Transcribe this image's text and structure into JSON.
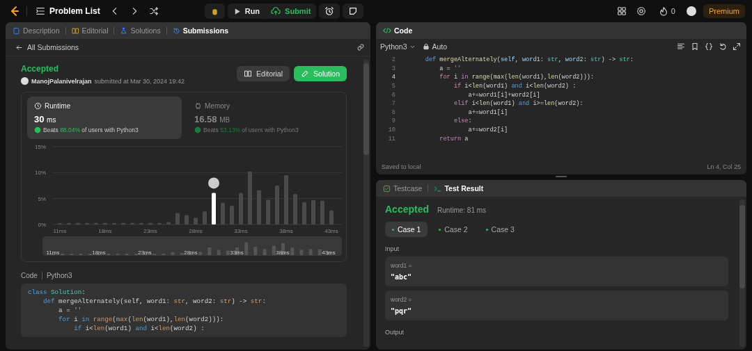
{
  "top_bar": {
    "title": "Problem List",
    "run_label": "Run",
    "submit_label": "Submit",
    "streak": "0",
    "premium": "Premium"
  },
  "left_panel": {
    "tabs": [
      {
        "label": "Description",
        "kind": "description",
        "selected": false
      },
      {
        "label": "Editorial",
        "kind": "editorial",
        "selected": false
      },
      {
        "label": "Solutions",
        "kind": "solutions",
        "selected": false
      },
      {
        "label": "Submissions",
        "kind": "submissions",
        "selected": true
      }
    ],
    "back_label": "All Submissions",
    "submission": {
      "status": "Accepted",
      "user": "ManojPalanivelrajan",
      "submitted_text": "submitted at Mar 30, 2024 19:42",
      "editorial_button": "Editorial",
      "solution_button": "Solution"
    },
    "metrics": [
      {
        "kind": "runtime",
        "label": "Runtime",
        "value": "30",
        "unit": "ms",
        "beats_label": "Beats",
        "beats_value": "88.04%",
        "beats_rest": "of users with Python3",
        "selected": true
      },
      {
        "kind": "memory",
        "label": "Memory",
        "value": "16.58",
        "unit": "MB",
        "beats_label": "Beats",
        "beats_value": "53.13%",
        "beats_rest": "of users with Python3",
        "selected": false
      }
    ],
    "chart_data": {
      "type": "bar",
      "categories": [
        "11ms",
        null,
        null,
        null,
        null,
        "18ms",
        null,
        null,
        null,
        null,
        "23ms",
        null,
        null,
        null,
        null,
        "28ms",
        null,
        null,
        null,
        null,
        "33ms",
        null,
        null,
        null,
        null,
        "38ms",
        null,
        null,
        null,
        null,
        "43ms"
      ],
      "series": [
        {
          "color": "#4a4a4a",
          "values": [
            0.2,
            0.3,
            0.3,
            0.3,
            0.3,
            0.3,
            0.3,
            0.3,
            0.3,
            0.3,
            0.3,
            0.3,
            0.5,
            2.2,
            1.8,
            1.3,
            2.5,
            null,
            4.2,
            3.6,
            6.1,
            10.2,
            6.6,
            4.8,
            7.5,
            9.5,
            5.9,
            4.3,
            4.7,
            4.6,
            2.7
          ]
        },
        {
          "color": "#ffffff",
          "values": [
            null,
            null,
            null,
            null,
            null,
            null,
            null,
            null,
            null,
            null,
            null,
            null,
            null,
            null,
            null,
            null,
            null,
            6.1,
            null,
            null,
            null,
            null,
            null,
            null,
            null,
            null,
            null,
            null,
            null,
            null,
            null
          ]
        }
      ],
      "ylim": [
        0,
        15
      ],
      "yticks": [
        {
          "value": 0,
          "label": "0%"
        },
        {
          "value": 5,
          "label": "5%"
        },
        {
          "value": 10,
          "label": "10%"
        },
        {
          "value": 15,
          "label": "15%"
        }
      ]
    },
    "navigator_labels": [
      "11ms",
      "18ms",
      "23ms",
      "28ms",
      "33ms",
      "38ms",
      "43ms"
    ],
    "code_header": {
      "label": "Code",
      "language": "Python3"
    },
    "code_lines": [
      [
        {
          "text": "class",
          "kind": "keyword"
        },
        {
          "text": " Solution",
          "kind": "type"
        },
        {
          "text": ":",
          "kind": "plain"
        }
      ],
      [
        {
          "text": "    def",
          "kind": "keyword"
        },
        {
          "text": " mergeAlternately(self, word1: ",
          "kind": "plain"
        },
        {
          "text": "str",
          "kind": "builtin"
        },
        {
          "text": ", word2: ",
          "kind": "plain"
        },
        {
          "text": "str",
          "kind": "builtin"
        },
        {
          "text": ") -> ",
          "kind": "plain"
        },
        {
          "text": "str",
          "kind": "builtin"
        },
        {
          "text": ":",
          "kind": "plain"
        }
      ],
      [
        {
          "text": "        a = ",
          "kind": "plain"
        },
        {
          "text": "''",
          "kind": "string"
        }
      ],
      [
        {
          "text": "        for",
          "kind": "keyword"
        },
        {
          "text": " i ",
          "kind": "plain"
        },
        {
          "text": "in",
          "kind": "keyword"
        },
        {
          "text": " range",
          "kind": "builtin"
        },
        {
          "text": "(",
          "kind": "plain"
        },
        {
          "text": "max",
          "kind": "builtin"
        },
        {
          "text": "(",
          "kind": "plain"
        },
        {
          "text": "len",
          "kind": "builtin"
        },
        {
          "text": "(word1),",
          "kind": "plain"
        },
        {
          "text": "len",
          "kind": "builtin"
        },
        {
          "text": "(word2))):",
          "kind": "plain"
        }
      ],
      [
        {
          "text": "            if",
          "kind": "keyword"
        },
        {
          "text": " i<",
          "kind": "plain"
        },
        {
          "text": "len",
          "kind": "builtin"
        },
        {
          "text": "(word1) ",
          "kind": "plain"
        },
        {
          "text": "and",
          "kind": "keyword"
        },
        {
          "text": " i<",
          "kind": "plain"
        },
        {
          "text": "len",
          "kind": "builtin"
        },
        {
          "text": "(word2) :",
          "kind": "plain"
        }
      ]
    ]
  },
  "editor": {
    "title": "Code",
    "language": "Python3",
    "mode": "Auto",
    "lines": [
      {
        "num": "2",
        "current": false,
        "tokens": [
          {
            "text": "    def",
            "kind": "keyword"
          },
          {
            "text": " mergeAlternately",
            "kind": "function"
          },
          {
            "text": "(",
            "kind": "plain"
          },
          {
            "text": "self",
            "kind": "param"
          },
          {
            "text": ", ",
            "kind": "plain"
          },
          {
            "text": "word1",
            "kind": "param"
          },
          {
            "text": ": ",
            "kind": "plain"
          },
          {
            "text": "str",
            "kind": "type"
          },
          {
            "text": ", ",
            "kind": "plain"
          },
          {
            "text": "word2",
            "kind": "param"
          },
          {
            "text": ": ",
            "kind": "plain"
          },
          {
            "text": "str",
            "kind": "type"
          },
          {
            "text": ") -> ",
            "kind": "plain"
          },
          {
            "text": "str",
            "kind": "type"
          },
          {
            "text": ":",
            "kind": "plain"
          }
        ]
      },
      {
        "num": "3",
        "current": false,
        "tokens": [
          {
            "text": "        a = ",
            "kind": "plain"
          },
          {
            "text": "''",
            "kind": "string"
          }
        ]
      },
      {
        "num": "4",
        "current": true,
        "tokens": [
          {
            "text": "        for",
            "kind": "control"
          },
          {
            "text": " i ",
            "kind": "plain"
          },
          {
            "text": "in",
            "kind": "control"
          },
          {
            "text": " range",
            "kind": "function"
          },
          {
            "text": "(",
            "kind": "plain"
          },
          {
            "text": "max",
            "kind": "function"
          },
          {
            "text": "(",
            "kind": "plain"
          },
          {
            "text": "len",
            "kind": "function"
          },
          {
            "text": "(word1),",
            "kind": "plain"
          },
          {
            "text": "len",
            "kind": "function"
          },
          {
            "text": "(word2))):",
            "kind": "plain"
          }
        ]
      },
      {
        "num": "5",
        "current": false,
        "tokens": [
          {
            "text": "            if",
            "kind": "control"
          },
          {
            "text": " i<",
            "kind": "plain"
          },
          {
            "text": "len",
            "kind": "function"
          },
          {
            "text": "(word1) ",
            "kind": "plain"
          },
          {
            "text": "and",
            "kind": "keyword"
          },
          {
            "text": " i<",
            "kind": "plain"
          },
          {
            "text": "len",
            "kind": "function"
          },
          {
            "text": "(word2) :",
            "kind": "plain"
          }
        ]
      },
      {
        "num": "6",
        "current": false,
        "tokens": [
          {
            "text": "                a+=word1[i]+word2[i]",
            "kind": "plain"
          }
        ]
      },
      {
        "num": "7",
        "current": false,
        "tokens": [
          {
            "text": "            elif",
            "kind": "control"
          },
          {
            "text": " i<",
            "kind": "plain"
          },
          {
            "text": "len",
            "kind": "function"
          },
          {
            "text": "(word1) ",
            "kind": "plain"
          },
          {
            "text": "and",
            "kind": "keyword"
          },
          {
            "text": " i>=",
            "kind": "plain"
          },
          {
            "text": "len",
            "kind": "function"
          },
          {
            "text": "(word2):",
            "kind": "plain"
          }
        ]
      },
      {
        "num": "8",
        "current": false,
        "tokens": [
          {
            "text": "                a+=word1[i]",
            "kind": "plain"
          }
        ]
      },
      {
        "num": "9",
        "current": false,
        "tokens": [
          {
            "text": "            else",
            "kind": "control"
          },
          {
            "text": ":",
            "kind": "plain"
          }
        ]
      },
      {
        "num": "10",
        "current": false,
        "tokens": [
          {
            "text": "                a+=word2[i]",
            "kind": "plain"
          }
        ]
      },
      {
        "num": "11",
        "current": false,
        "tokens": [
          {
            "text": "        return",
            "kind": "control"
          },
          {
            "text": " a",
            "kind": "plain"
          }
        ]
      }
    ],
    "status_left": "Saved to local",
    "status_right": "Ln 4, Col 25"
  },
  "test_panel": {
    "tabs": [
      {
        "label": "Testcase",
        "kind": "testcase",
        "selected": false
      },
      {
        "label": "Test Result",
        "kind": "result",
        "selected": true
      }
    ],
    "status": "Accepted",
    "runtime": "Runtime: 81 ms",
    "cases": [
      {
        "label": "Case 1",
        "selected": true
      },
      {
        "label": "Case 2",
        "selected": false
      },
      {
        "label": "Case 3",
        "selected": false
      }
    ],
    "input_label": "Input",
    "inputs": [
      {
        "name": "word1 =",
        "value": "\"abc\""
      },
      {
        "name": "word2 =",
        "value": "\"pqr\""
      }
    ],
    "output_label": "Output"
  }
}
